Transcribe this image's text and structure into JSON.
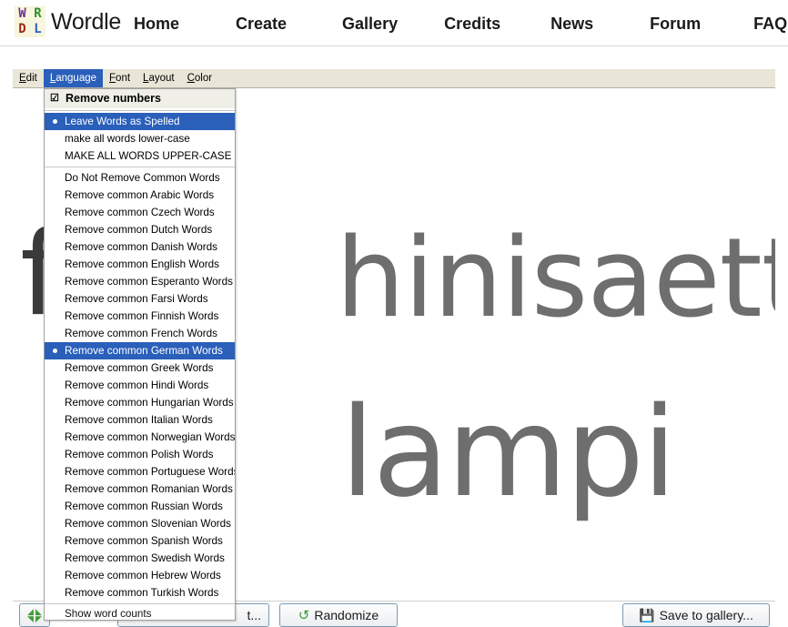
{
  "site": {
    "logo": {
      "cells": [
        "W",
        "R",
        "D",
        "L"
      ],
      "wordmark": "Wordle"
    },
    "nav": [
      {
        "label": "Home"
      },
      {
        "label": "Create"
      },
      {
        "label": "Gallery"
      },
      {
        "label": "Credits"
      },
      {
        "label": "News"
      },
      {
        "label": "Forum"
      },
      {
        "label": "FAQ"
      }
    ]
  },
  "applet": {
    "menubar": [
      {
        "label": "Edit",
        "mnemonic": "E",
        "active": false
      },
      {
        "label": "Language",
        "mnemonic": "L",
        "active": true
      },
      {
        "label": "Font",
        "mnemonic": "F",
        "active": false
      },
      {
        "label": "Layout",
        "mnemonic": "L",
        "active": false
      },
      {
        "label": "Color",
        "mnemonic": "C",
        "active": false
      }
    ],
    "menu": {
      "checkbox_item": {
        "label": "Remove numbers",
        "checked": true,
        "check_glyph": "☑"
      },
      "case_group": [
        {
          "label": "Leave Words as Spelled",
          "selected": true
        },
        {
          "label": "make all words lower-case",
          "selected": false
        },
        {
          "label": "MAKE ALL WORDS UPPER-CASE",
          "selected": false
        }
      ],
      "language_group": [
        {
          "label": "Do Not Remove Common Words",
          "selected": false
        },
        {
          "label": "Remove common Arabic Words",
          "selected": false
        },
        {
          "label": "Remove common Czech Words",
          "selected": false
        },
        {
          "label": "Remove common Dutch Words",
          "selected": false
        },
        {
          "label": "Remove common Danish Words",
          "selected": false
        },
        {
          "label": "Remove common English Words",
          "selected": false
        },
        {
          "label": "Remove common Esperanto Words",
          "selected": false
        },
        {
          "label": "Remove common Farsi Words",
          "selected": false
        },
        {
          "label": "Remove common Finnish Words",
          "selected": false
        },
        {
          "label": "Remove common French Words",
          "selected": false
        },
        {
          "label": "Remove common German Words",
          "selected": true
        },
        {
          "label": "Remove common Greek Words",
          "selected": false
        },
        {
          "label": "Remove common Hindi Words",
          "selected": false
        },
        {
          "label": "Remove common Hungarian Words",
          "selected": false
        },
        {
          "label": "Remove common Italian Words",
          "selected": false
        },
        {
          "label": "Remove common Norwegian Words",
          "selected": false
        },
        {
          "label": "Remove common Polish Words",
          "selected": false
        },
        {
          "label": "Remove common Portuguese Words",
          "selected": false
        },
        {
          "label": "Remove common Romanian Words",
          "selected": false
        },
        {
          "label": "Remove common Russian Words",
          "selected": false
        },
        {
          "label": "Remove common Slovenian Words",
          "selected": false
        },
        {
          "label": "Remove common Spanish Words",
          "selected": false
        },
        {
          "label": "Remove common Swedish Words",
          "selected": false
        },
        {
          "label": "Remove common Hebrew Words",
          "selected": false
        },
        {
          "label": "Remove common Turkish Words",
          "selected": false
        }
      ],
      "trailing_item": {
        "label": "Show word counts"
      }
    },
    "word_cloud": {
      "words": [
        {
          "text": "f",
          "color": "#3a3a3a"
        },
        {
          "text": "hinisaette",
          "color": "#6e6e6e"
        },
        {
          "text": "lampi",
          "color": "#6e6e6e"
        }
      ]
    },
    "toolbar": {
      "fullscreen_label": "",
      "print_label": "t...",
      "randomize_label": "Randomize",
      "save_label": "Save to gallery...",
      "icons": {
        "fullscreen": "expand-arrows-icon",
        "randomize": "refresh-icon",
        "save": "floppy-disk-icon"
      }
    }
  },
  "colors": {
    "menu_highlight": "#2a5fba",
    "menubar_bg": "#e9e6d8",
    "logo_w": "#6b2d8f",
    "logo_r": "#2f8f2f",
    "logo_d": "#9b2a18",
    "logo_l": "#2a5fc4",
    "icon_green": "#3f9b35"
  }
}
